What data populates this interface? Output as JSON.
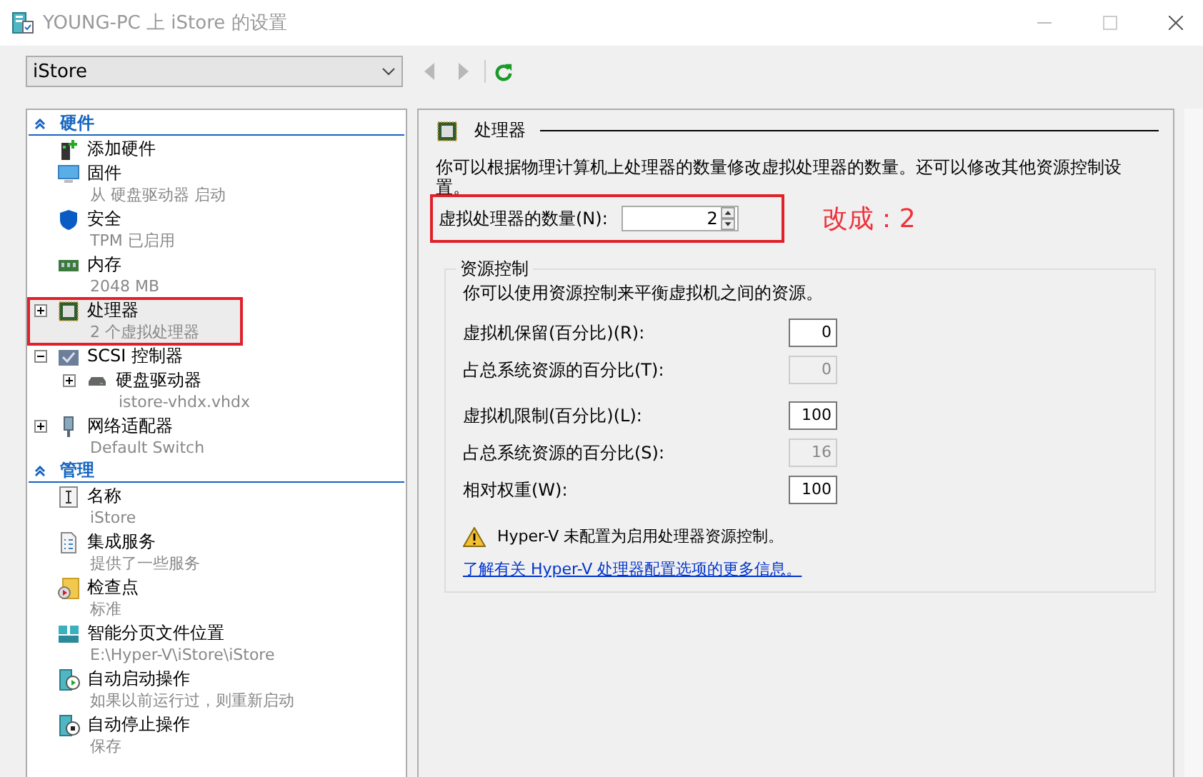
{
  "window": {
    "title": "YOUNG-PC 上 iStore 的设置"
  },
  "vm_selector": {
    "value": "iStore"
  },
  "tree": [
    {
      "section": "硬件",
      "items": [
        {
          "kind": "add",
          "name": "添加硬件",
          "selected": false,
          "highlighted": false
        },
        {
          "kind": "firmware",
          "name": "固件",
          "detail": "从 硬盘驱动器 启动",
          "selected": false,
          "highlighted": false
        },
        {
          "kind": "shield",
          "name": "安全",
          "detail": "TPM 已启用",
          "selected": false,
          "highlighted": false
        },
        {
          "kind": "memory",
          "name": "内存",
          "detail": "2048 MB",
          "selected": false,
          "highlighted": false
        },
        {
          "kind": "cpu",
          "name": "处理器",
          "detail": "2 个虚拟处理器",
          "expandable": true,
          "expanded": false,
          "selected": true,
          "highlighted": true
        },
        {
          "kind": "scsi",
          "name": "SCSI 控制器",
          "expandable": true,
          "expanded": true,
          "selected": false,
          "highlighted": false,
          "children": [
            {
              "kind": "disk",
              "name": "硬盘驱动器",
              "detail": "istore-vhdx.vhdx",
              "expandable": true,
              "expanded": false,
              "selected": false,
              "highlighted": false
            }
          ]
        },
        {
          "kind": "network",
          "name": "网络适配器",
          "detail": "Default Switch",
          "expandable": true,
          "expanded": false,
          "selected": false,
          "highlighted": false
        }
      ]
    },
    {
      "section": "管理",
      "items": [
        {
          "kind": "name",
          "name": "名称",
          "detail": "iStore",
          "selected": false,
          "highlighted": false
        },
        {
          "kind": "services",
          "name": "集成服务",
          "detail": "提供了一些服务",
          "selected": false,
          "highlighted": false
        },
        {
          "kind": "checkpoint",
          "name": "检查点",
          "detail": "标准",
          "selected": false,
          "highlighted": false
        },
        {
          "kind": "paging",
          "name": "智能分页文件位置",
          "detail": "E:\\Hyper-V\\iStore\\iStore",
          "selected": false,
          "highlighted": false
        },
        {
          "kind": "autostart",
          "name": "自动启动操作",
          "detail": "如果以前运行过，则重新启动",
          "selected": false,
          "highlighted": false
        },
        {
          "kind": "autostop",
          "name": "自动停止操作",
          "detail": "保存",
          "selected": false,
          "highlighted": false
        }
      ]
    }
  ],
  "panel": {
    "heading": "处理器",
    "description": "你可以根据物理计算机上处理器的数量修改虚拟处理器的数量。还可以修改其他资源控制设置。",
    "processor_count": {
      "label": "虚拟处理器的数量(N):",
      "value": "2",
      "highlighted": true
    },
    "annotation": "改成：2",
    "resource_control": {
      "title": "资源控制",
      "description": "你可以使用资源控制来平衡虚拟机之间的资源。",
      "fields": [
        {
          "label": "虚拟机保留(百分比)(R):",
          "value": "0",
          "disabled": false
        },
        {
          "label": "占总系统资源的百分比(T):",
          "value": "0",
          "disabled": true
        },
        {
          "label": "虚拟机限制(百分比)(L):",
          "value": "100",
          "disabled": false
        },
        {
          "label": "占总系统资源的百分比(S):",
          "value": "16",
          "disabled": true
        },
        {
          "label": "相对权重(W):",
          "value": "100",
          "disabled": false
        }
      ],
      "warning": "Hyper-V 未配置为启用处理器资源控制。",
      "link": "了解有关 Hyper-V 处理器配置选项的更多信息。"
    }
  }
}
